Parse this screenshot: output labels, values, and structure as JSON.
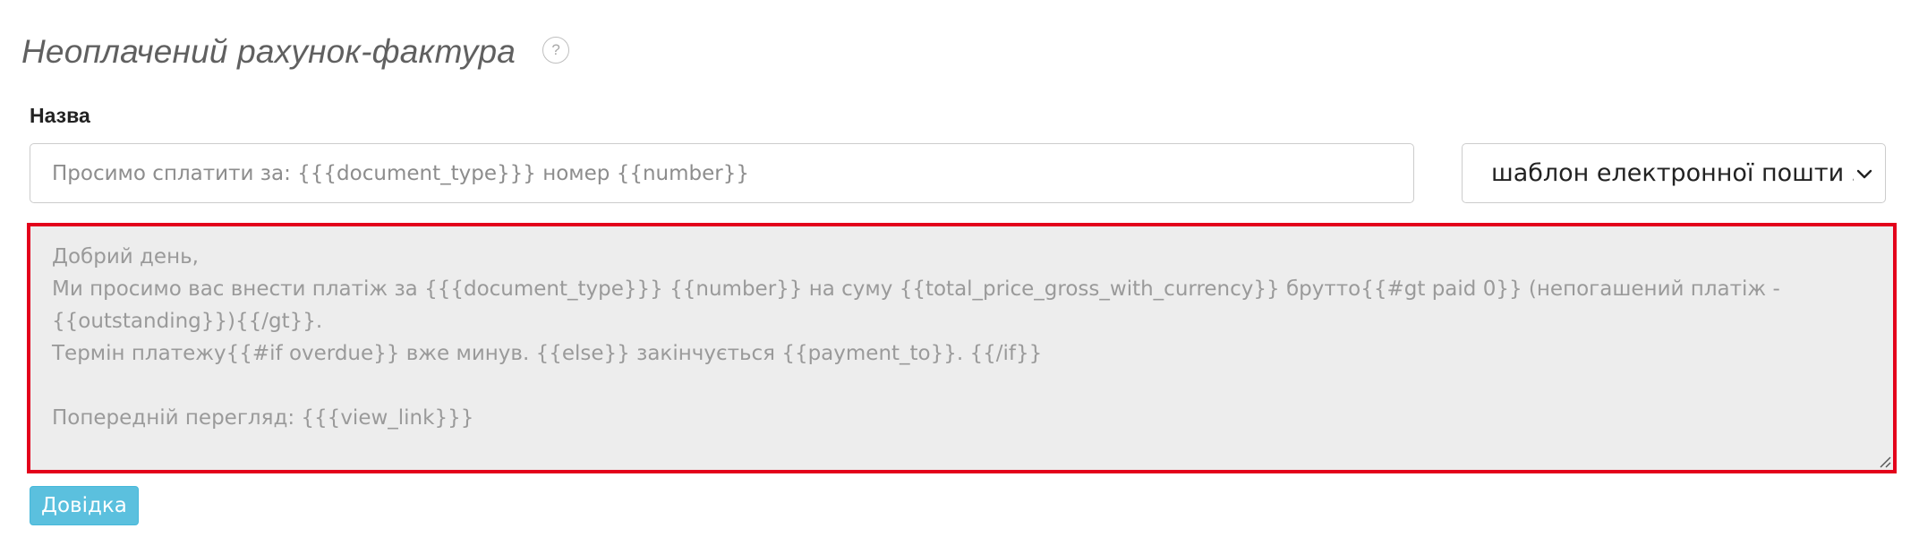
{
  "header": {
    "title": "Неоплачений рахунок-фактура",
    "help_icon_glyph": "?"
  },
  "form": {
    "subject_label": "Назва",
    "subject_placeholder": "Просимо сплатити за: {{{document_type}}} номер {{number}}",
    "template_select": {
      "selected": "шаблон електронної пошти за замовчуванням",
      "icon": "chevron-down-icon"
    },
    "body_text": "Добрий день,\nМи просимо вас внести платіж за {{{document_type}}} {{number}} на суму {{total_price_gross_with_currency}} брутто{{#gt paid 0}} (непогашений платіж - {{outstanding}}){{/gt}}.\nТермін платежу{{#if overdue}} вже минув. {{else}} закінчується {{payment_to}}. {{/if}}\n\nПопередній перегляд: {{{view_link}}}",
    "help_button_label": "Довідка"
  },
  "colors": {
    "highlight_border": "#e3001b",
    "help_button_bg": "#5bc0de",
    "textarea_bg": "#ededed"
  }
}
